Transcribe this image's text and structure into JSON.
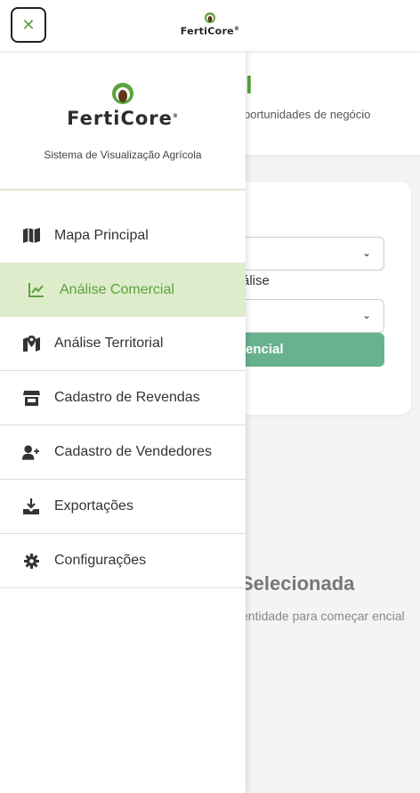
{
  "topbar": {
    "close_symbol": "✕",
    "brand": "FertiCore",
    "brand_mark": "®"
  },
  "background": {
    "heading_fragment": "l",
    "subtitle_fragment": "portunidades de negócio",
    "select_label_fragment": "álise",
    "button_fragment": "encial",
    "empty_title_fragment": "Selecionada",
    "empty_text_fragment": "entidade para começar encial"
  },
  "drawer": {
    "brand": "FertiCore",
    "brand_mark": "®",
    "tagline": "Sistema de Visualização Agrícola",
    "items": [
      {
        "label": "Mapa Principal",
        "icon": "map-icon",
        "active": false
      },
      {
        "label": "Análise Comercial",
        "icon": "chart-line-icon",
        "active": true
      },
      {
        "label": "Análise Territorial",
        "icon": "map-marker-icon",
        "active": false
      },
      {
        "label": "Cadastro de Revendas",
        "icon": "store-icon",
        "active": false
      },
      {
        "label": "Cadastro de Vendedores",
        "icon": "user-plus-icon",
        "active": false
      },
      {
        "label": "Exportações",
        "icon": "download-icon",
        "active": false
      },
      {
        "label": "Configurações",
        "icon": "gear-icon",
        "active": false
      }
    ]
  },
  "colors": {
    "accent": "#5aa33c",
    "active_bg": "#dfeccb",
    "button_bg": "#69b28f"
  }
}
